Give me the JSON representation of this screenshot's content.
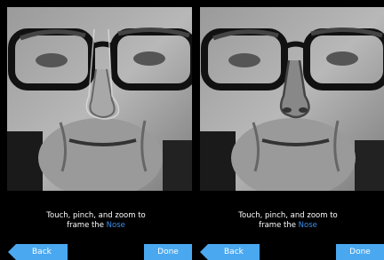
{
  "panels": [
    {
      "instruction_line1": "Touch, pinch, and zoom to",
      "instruction_prefix": "frame the ",
      "feature_name": "Nose",
      "back_label": "Back",
      "done_label": "Done"
    },
    {
      "instruction_line1": "Touch, pinch, and zoom to",
      "instruction_prefix": "frame the ",
      "feature_name": "Nose",
      "back_label": "Back",
      "done_label": "Done"
    }
  ],
  "colors": {
    "accent": "#4aa8f0",
    "feature_text": "#3b8ff0",
    "background": "#000000"
  }
}
